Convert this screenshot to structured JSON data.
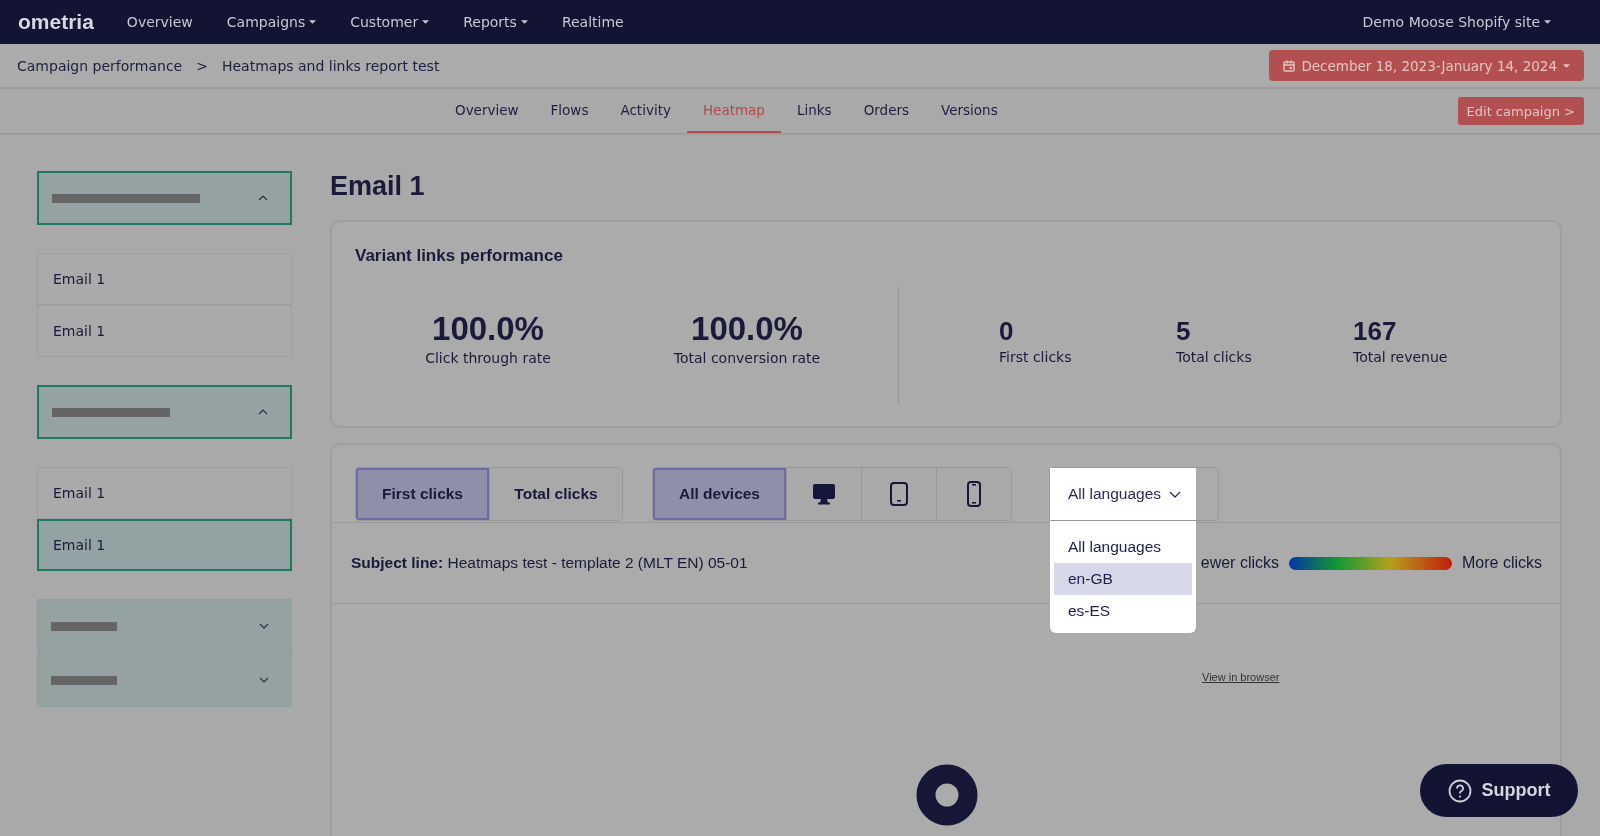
{
  "topbar": {
    "logo": "ometria",
    "nav": [
      {
        "label": "Overview",
        "has_menu": false
      },
      {
        "label": "Campaigns",
        "has_menu": true
      },
      {
        "label": "Customer",
        "has_menu": true
      },
      {
        "label": "Reports",
        "has_menu": true
      },
      {
        "label": "Realtime",
        "has_menu": false
      }
    ],
    "site": "Demo Moose Shopify site"
  },
  "breadcrumb": [
    "Campaign performance",
    ">",
    "Heatmaps and links report test"
  ],
  "date_range": "December 18, 2023-January 14, 2024",
  "tabs": [
    {
      "label": "Overview",
      "selected": false
    },
    {
      "label": "Flows",
      "selected": false
    },
    {
      "label": "Activity",
      "selected": false
    },
    {
      "label": "Heatmap",
      "selected": true
    },
    {
      "label": "Links",
      "selected": false
    },
    {
      "label": "Orders",
      "selected": false
    },
    {
      "label": "Versions",
      "selected": false
    }
  ],
  "edit_button": "Edit campaign >",
  "sidebar": {
    "groups": [
      {
        "expanded": true,
        "items": [
          {
            "label": "Email 1",
            "selected": false
          },
          {
            "label": "Email 1",
            "selected": false
          }
        ]
      },
      {
        "expanded": true,
        "items": [
          {
            "label": "Email 1",
            "selected": false
          },
          {
            "label": "Email 1",
            "selected": true
          }
        ]
      },
      {
        "expanded": false
      },
      {
        "expanded": false
      }
    ]
  },
  "title": "Email 1",
  "summary": {
    "title": "Variant links performance",
    "rates": [
      {
        "value": "100.0%",
        "label": "Click through rate"
      },
      {
        "value": "100.0%",
        "label": "Total conversion rate"
      }
    ],
    "counts": [
      {
        "value": "0",
        "label": "First clicks"
      },
      {
        "value": "5",
        "label": "Total clicks"
      },
      {
        "value": "167",
        "label": "Total revenue"
      }
    ]
  },
  "filters": {
    "click_types": [
      {
        "label": "First clicks",
        "selected": true
      },
      {
        "label": "Total clicks",
        "selected": false
      }
    ],
    "devices": [
      {
        "kind": "all",
        "label": "All devices",
        "selected": true
      },
      {
        "kind": "desktop",
        "selected": false
      },
      {
        "kind": "tablet",
        "selected": false
      },
      {
        "kind": "phone",
        "selected": false
      }
    ],
    "language": {
      "value": "All languages",
      "expanded": true,
      "options": [
        {
          "label": "All languages",
          "highlighted": false
        },
        {
          "label": "en-GB",
          "highlighted": true
        },
        {
          "label": "es-ES",
          "highlighted": false
        }
      ]
    }
  },
  "subject": "**Subject line:** Heatmaps test - template 2 (MLT EN) 05-01",
  "legend": {
    "low": "ewer clicks",
    "high": "More clicks"
  },
  "preview_link": "View in browser",
  "support": "Support"
}
